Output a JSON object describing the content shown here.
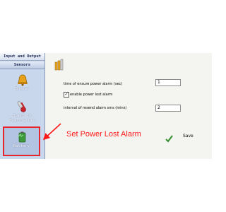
{
  "sidebar": {
    "section_io": "Input and Output",
    "section_sensors": "Sensors",
    "items": [
      {
        "label": "Buzzer"
      },
      {
        "label": "Build-in Temparature"
      },
      {
        "label": "Battery"
      }
    ]
  },
  "main": {
    "ensure_label": "time of ensure power alarm (sec)",
    "ensure_value": "1",
    "enable_label": "enable power lost alarm",
    "enable_checked": true,
    "resend_label": "interval of resend alarm sms (mins)",
    "resend_value": "2",
    "save_label": "Save"
  },
  "annotation": {
    "text": "Set Power Lost Alarm",
    "color": "#ff1a1a"
  },
  "colors": {
    "sidebar_bg": "#c9d7ec",
    "highlight": "#e8232b"
  }
}
